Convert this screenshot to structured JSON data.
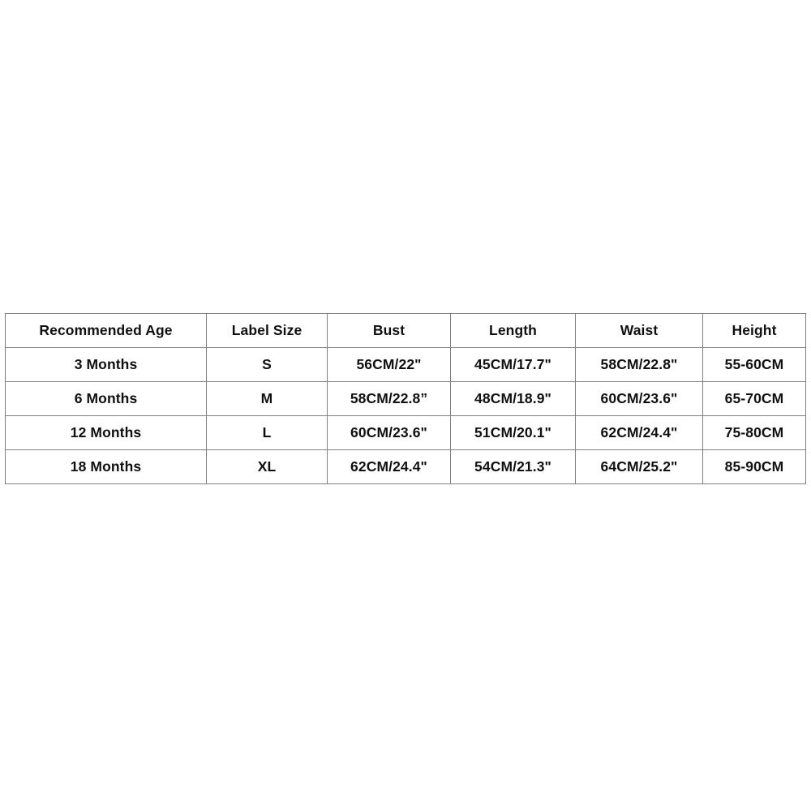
{
  "table": {
    "columns": [
      "Recommended Age",
      "Label Size",
      "Bust",
      "Length",
      "Waist",
      "Height"
    ],
    "rows": [
      {
        "age": "3 Months",
        "label_size": "S",
        "bust": "56CM/22\"",
        "length": "45CM/17.7\"",
        "waist": "58CM/22.8\"",
        "height": "55-60CM"
      },
      {
        "age": "6 Months",
        "label_size": "M",
        "bust": "58CM/22.8”",
        "length": "48CM/18.9\"",
        "waist": "60CM/23.6\"",
        "height": "65-70CM"
      },
      {
        "age": "12 Months",
        "label_size": "L",
        "bust": "60CM/23.6\"",
        "length": "51CM/20.1\"",
        "waist": "62CM/24.4\"",
        "height": "75-80CM"
      },
      {
        "age": "18 Months",
        "label_size": "XL",
        "bust": "62CM/24.4\"",
        "length": "54CM/21.3\"",
        "waist": "64CM/25.2\"",
        "height": "85-90CM"
      }
    ],
    "colors": {
      "background": "#ffffff",
      "border": "#808080",
      "text": "#101010"
    }
  }
}
